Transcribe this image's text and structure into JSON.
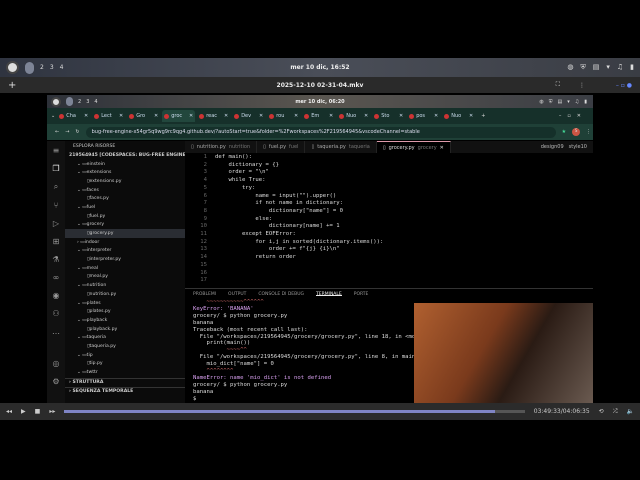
{
  "desktop": {
    "workspaces": [
      "2",
      "3",
      "4"
    ],
    "clock": "mer 10 dic, 16:52"
  },
  "player": {
    "title": "2025-12-10 02-31-04.mkv",
    "time": "03:49:33/04:06:35",
    "progress": 0.935
  },
  "inner": {
    "workspaces": [
      "2",
      "3",
      "4"
    ],
    "clock": "mer 10 dic, 06:20"
  },
  "browser": {
    "tabs": [
      "Cha",
      "Lect",
      "Gro",
      "groc",
      "reac",
      "Dev",
      "rou",
      "Em",
      "Nuo",
      "Sto",
      "pos",
      "Nuo"
    ],
    "active_tab": 3,
    "url": "bug-free-engine-x54gr5q9wg9rc9qg4.github.dev/?autoStart=true&folder=%2Fworkspaces%2F219564945&vscodeChannel=stable",
    "profile": "S"
  },
  "explorer": {
    "title": "ESPLORA RISORSE",
    "root": "219564945 [CODESPACES: BUG-FREE ENGINE]",
    "items": [
      {
        "n": "einstein",
        "d": 1
      },
      {
        "n": "extensions",
        "d": 1
      },
      {
        "n": "extensions.py",
        "d": 2
      },
      {
        "n": "faces",
        "d": 1
      },
      {
        "n": "faces.py",
        "d": 2
      },
      {
        "n": "fuel",
        "d": 1
      },
      {
        "n": "fuel.py",
        "d": 2
      },
      {
        "n": "grocery",
        "d": 1
      },
      {
        "n": "grocery.py",
        "d": 2
      },
      {
        "n": "indoor",
        "d": 1
      },
      {
        "n": "interpreter",
        "d": 1
      },
      {
        "n": "interpreter.py",
        "d": 2
      },
      {
        "n": "meal",
        "d": 1
      },
      {
        "n": "meal.py",
        "d": 2
      },
      {
        "n": "nutrition",
        "d": 1
      },
      {
        "n": "nutrition.py",
        "d": 2
      },
      {
        "n": "plates",
        "d": 1
      },
      {
        "n": "plates.py",
        "d": 2
      },
      {
        "n": "playback",
        "d": 1
      },
      {
        "n": "playback.py",
        "d": 2
      },
      {
        "n": "taqueria",
        "d": 1
      },
      {
        "n": "taqueria.py",
        "d": 2
      },
      {
        "n": "tip",
        "d": 1
      },
      {
        "n": "tip.py",
        "d": 2
      },
      {
        "n": "twttr",
        "d": 1
      }
    ],
    "outline": "STRUTTURA",
    "timeline": "SEQUENZA TEMPORALE"
  },
  "editor": {
    "tabs": [
      {
        "name": "nutrition.py",
        "dir": "nutrition"
      },
      {
        "name": "fuel.py",
        "dir": "fuel"
      },
      {
        "name": "taqueria.py",
        "dir": "taqueria"
      },
      {
        "name": "grocery.py",
        "dir": "grocery"
      }
    ],
    "right": [
      "design09",
      "style10"
    ],
    "lines": [
      "def main():",
      "    dictionary = {}",
      "    order = \"\\n\"",
      "    while True:",
      "        try:",
      "            name = input(\"\").upper()",
      "            if not name in dictionary:",
      "                dictionary[\"name\"] = 0",
      "            else:",
      "                dictionary[name] += 1",
      "        except EOFError:",
      "            for i,j in sorted(dictionary.items()):",
      "                order += f\"{j} {i}\\n\"",
      "            return order",
      "",
      "",
      ""
    ]
  },
  "panel": {
    "tabs": [
      "PROBLEMI",
      "OUTPUT",
      "CONSOLE DI DEBUG",
      "TERMINALE",
      "PORTE"
    ],
    "terminal": [
      "    ~~~~~~~~~~~^^^^^^",
      "KeyError: 'BANANA'",
      "grocery/ $ python grocery.py",
      "banana",
      "Traceback (most recent call last):",
      "  File \"/workspaces/219564945/grocery/grocery.py\", line 18, in <module>",
      "    print(main())",
      "          ~~~~^^",
      "  File \"/workspaces/219564945/grocery/grocery.py\", line 8, in main",
      "    mio_dict[\"name\"] = 0",
      "    ^^^^^^^^",
      "NameError: name 'mio_dict' is not defined",
      "grocery/ $ python grocery.py",
      "banana",
      "$"
    ]
  }
}
